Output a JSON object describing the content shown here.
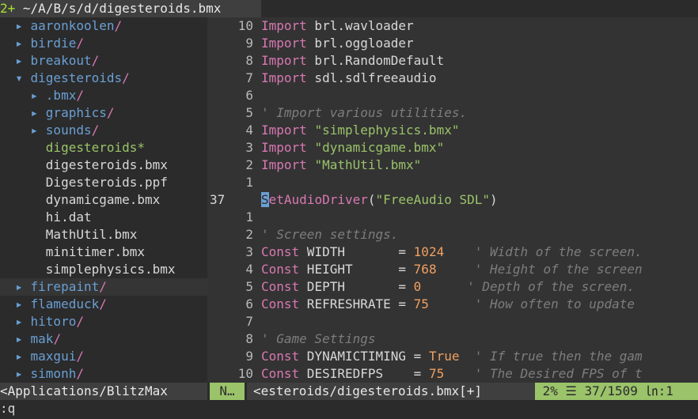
{
  "tabline": {
    "tab_number": "2+",
    "tab_path": "~/A/B/s/d/digesteroids.bmx"
  },
  "tree": [
    {
      "type": "dir",
      "depth": 0,
      "arrow": "▸",
      "name": "aaronkoolen",
      "slash": "/"
    },
    {
      "type": "dir",
      "depth": 0,
      "arrow": "▸",
      "name": "birdie",
      "slash": "/"
    },
    {
      "type": "dir",
      "depth": 0,
      "arrow": "▸",
      "name": "breakout",
      "slash": "/"
    },
    {
      "type": "dir",
      "depth": 0,
      "arrow": "▾",
      "name": "digesteroids",
      "slash": "/"
    },
    {
      "type": "dir",
      "depth": 1,
      "arrow": "▸",
      "name": ".bmx",
      "slash": "/"
    },
    {
      "type": "dir",
      "depth": 1,
      "arrow": "▸",
      "name": "graphics",
      "slash": "/"
    },
    {
      "type": "dir",
      "depth": 1,
      "arrow": "▸",
      "name": "sounds",
      "slash": "/"
    },
    {
      "type": "exe",
      "depth": 1,
      "name": "digesteroids*"
    },
    {
      "type": "file",
      "depth": 1,
      "name": "digesteroids.bmx"
    },
    {
      "type": "file",
      "depth": 1,
      "name": "Digesteroids.ppf"
    },
    {
      "type": "file",
      "depth": 1,
      "name": "dynamicgame.bmx"
    },
    {
      "type": "file",
      "depth": 1,
      "name": "hi.dat"
    },
    {
      "type": "file",
      "depth": 1,
      "name": "MathUtil.bmx"
    },
    {
      "type": "file",
      "depth": 1,
      "name": "minitimer.bmx"
    },
    {
      "type": "file",
      "depth": 1,
      "name": "simplephysics.bmx"
    },
    {
      "type": "dir",
      "depth": 0,
      "arrow": "▸",
      "name": "firepaint",
      "slash": "/",
      "selected": true
    },
    {
      "type": "dir",
      "depth": 0,
      "arrow": "▸",
      "name": "flameduck",
      "slash": "/"
    },
    {
      "type": "dir",
      "depth": 0,
      "arrow": "▸",
      "name": "hitoro",
      "slash": "/"
    },
    {
      "type": "dir",
      "depth": 0,
      "arrow": "▸",
      "name": "mak",
      "slash": "/"
    },
    {
      "type": "dir",
      "depth": 0,
      "arrow": "▸",
      "name": "maxgui",
      "slash": "/"
    },
    {
      "type": "dir",
      "depth": 0,
      "arrow": "▸",
      "name": "simonh",
      "slash": "/"
    }
  ],
  "code": [
    {
      "n": "10",
      "t": [
        [
          "kw",
          "Import"
        ],
        [
          "code",
          " brl.wavloader"
        ]
      ]
    },
    {
      "n": "9",
      "t": [
        [
          "kw",
          "Import"
        ],
        [
          "code",
          " brl.oggloader"
        ]
      ]
    },
    {
      "n": "8",
      "t": [
        [
          "kw",
          "Import"
        ],
        [
          "code",
          " brl.RandomDefault"
        ]
      ]
    },
    {
      "n": "7",
      "t": [
        [
          "kw",
          "Import"
        ],
        [
          "code",
          " sdl.sdlfreeaudio"
        ]
      ]
    },
    {
      "n": "6",
      "t": []
    },
    {
      "n": "5",
      "t": [
        [
          "cmt",
          "' Import various utilities."
        ]
      ]
    },
    {
      "n": "4",
      "t": [
        [
          "kw",
          "Import"
        ],
        [
          "code",
          " "
        ],
        [
          "str",
          "\"simplephysics.bmx\""
        ]
      ]
    },
    {
      "n": "3",
      "t": [
        [
          "kw",
          "Import"
        ],
        [
          "code",
          " "
        ],
        [
          "str",
          "\"dynamicgame.bmx\""
        ]
      ]
    },
    {
      "n": "2",
      "t": [
        [
          "kw",
          "Import"
        ],
        [
          "code",
          " "
        ],
        [
          "str",
          "\"MathUtil.bmx\""
        ]
      ]
    },
    {
      "n": "1",
      "t": []
    },
    {
      "n": "37",
      "cur": true,
      "t": [
        [
          "cursor",
          "S"
        ],
        [
          "kw",
          "etAudioDriver"
        ],
        [
          "code",
          "("
        ],
        [
          "str",
          "\"FreeAudio SDL\""
        ],
        [
          "code",
          ")"
        ]
      ]
    },
    {
      "n": "1",
      "t": []
    },
    {
      "n": "2",
      "t": [
        [
          "cmt",
          "' Screen settings."
        ]
      ]
    },
    {
      "n": "3",
      "t": [
        [
          "kw",
          "Const"
        ],
        [
          "code",
          " WIDTH       = "
        ],
        [
          "num",
          "1024"
        ],
        [
          "code",
          "    "
        ],
        [
          "cmt",
          "' Width of the screen."
        ]
      ]
    },
    {
      "n": "4",
      "t": [
        [
          "kw",
          "Const"
        ],
        [
          "code",
          " HEIGHT      = "
        ],
        [
          "num",
          "768"
        ],
        [
          "code",
          "     "
        ],
        [
          "cmt",
          "' Height of the screen"
        ]
      ]
    },
    {
      "n": "5",
      "t": [
        [
          "kw",
          "Const"
        ],
        [
          "code",
          " DEPTH       = "
        ],
        [
          "num",
          "0"
        ],
        [
          "code",
          "      "
        ],
        [
          "cmt",
          "' Depth of the screen."
        ]
      ]
    },
    {
      "n": "6",
      "t": [
        [
          "kw",
          "Const"
        ],
        [
          "code",
          " REFRESHRATE = "
        ],
        [
          "num",
          "75"
        ],
        [
          "code",
          "      "
        ],
        [
          "cmt",
          "' How often to update"
        ]
      ]
    },
    {
      "n": "7",
      "t": []
    },
    {
      "n": "8",
      "t": [
        [
          "cmt",
          "' Game Settings"
        ]
      ]
    },
    {
      "n": "9",
      "t": [
        [
          "kw",
          "Const"
        ],
        [
          "code",
          " DYNAMICTIMING = "
        ],
        [
          "bool",
          "True"
        ],
        [
          "code",
          "  "
        ],
        [
          "cmt",
          "' If true then the gam"
        ]
      ]
    },
    {
      "n": "10",
      "t": [
        [
          "kw",
          "Const"
        ],
        [
          "code",
          " DESIREDFPS    = "
        ],
        [
          "num",
          "75"
        ],
        [
          "code",
          "    "
        ],
        [
          "cmt",
          "' The Desired FPS of t"
        ]
      ]
    }
  ],
  "status": {
    "tree_path": "<Applications/BlitzMax",
    "mode": "N…",
    "filename": "<esteroids/digesteroids.bmx[+]",
    "position": " 2% ☰ 37/1509 ㏑:1 "
  },
  "cmdline": ":q"
}
